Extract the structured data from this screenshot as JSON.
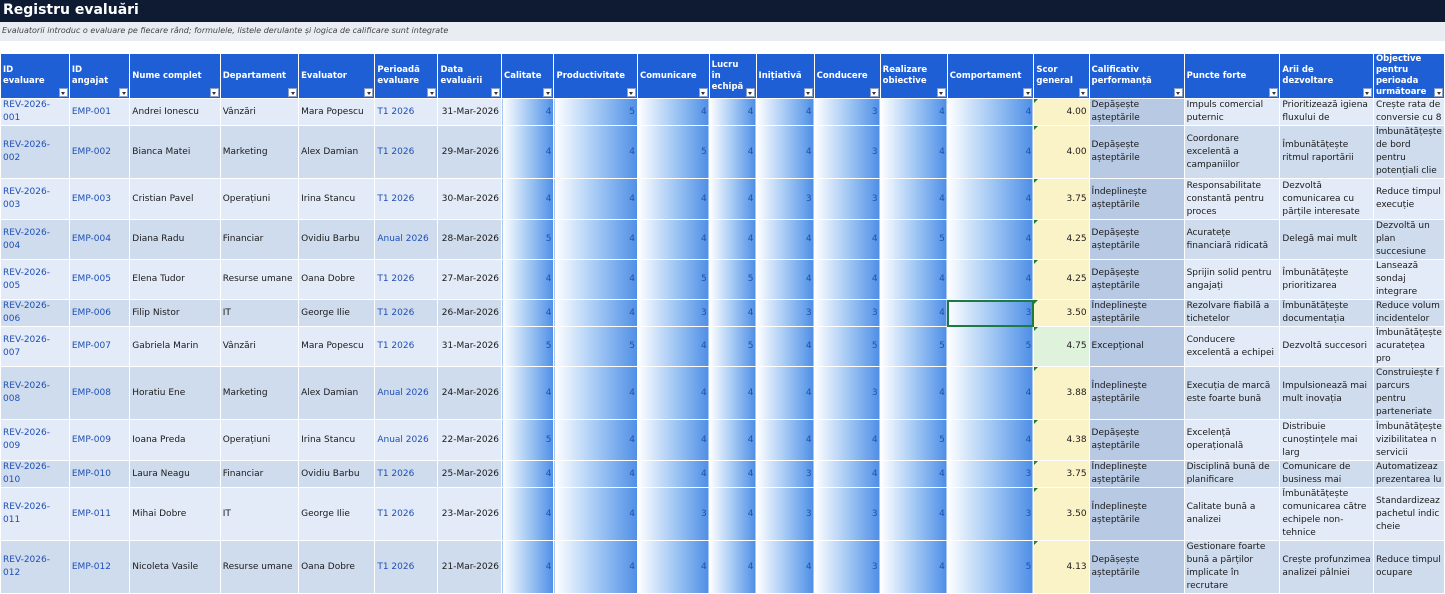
{
  "sheet": {
    "title": "Registru evaluări",
    "subtitle": "Evaluatorii introduc o evaluare pe fiecare rând; formulele, listele derulante și logica de calificare sunt integrate"
  },
  "columns": [
    "ID evaluare",
    "ID angajat",
    "Nume complet",
    "Departament",
    "Evaluator",
    "Perioadă evaluare",
    "Data evaluării",
    "Calitate",
    "Productivitate",
    "Comunicare",
    "Lucru în echipă",
    "Inițiativă",
    "Conducere",
    "Realizare obiective",
    "Comportament",
    "Scor general",
    "Calificativ performanță",
    "Puncte forte",
    "Arii de dezvoltare",
    "Objective pentru perioada următoare"
  ],
  "rows": [
    [
      "REV-2026-001",
      "EMP-001",
      "Andrei Ionescu",
      "Vânzări",
      "Mara Popescu",
      "T1 2026",
      "31-Mar-2026",
      "4",
      "5",
      "4",
      "4",
      "4",
      "3",
      "4",
      "4",
      "4.00",
      "Depășește așteptările",
      "Impuls comercial puternic",
      "Prioritizează igiena fluxului de",
      "Crește rata de conversie cu 8"
    ],
    [
      "REV-2026-002",
      "EMP-002",
      "Bianca Matei",
      "Marketing",
      "Alex Damian",
      "T1 2026",
      "29-Mar-2026",
      "4",
      "4",
      "5",
      "4",
      "4",
      "3",
      "4",
      "4",
      "4.00",
      "Depășește așteptările",
      "Coordonare excelentă a campaniilor",
      "Îmbunătățește ritmul raportării",
      "Îmbunătățește de bord pentru potențiali clie"
    ],
    [
      "REV-2026-003",
      "EMP-003",
      "Cristian Pavel",
      "Operațiuni",
      "Irina Stancu",
      "T1 2026",
      "30-Mar-2026",
      "4",
      "4",
      "4",
      "4",
      "3",
      "3",
      "4",
      "4",
      "3.75",
      "Îndeplinește așteptările",
      "Responsabilitate constantă pentru proces",
      "Dezvoltă comunicarea cu părțile interesate",
      "Reduce timpul execuție"
    ],
    [
      "REV-2026-004",
      "EMP-004",
      "Diana Radu",
      "Financiar",
      "Ovidiu Barbu",
      "Anual 2026",
      "28-Mar-2026",
      "5",
      "4",
      "4",
      "4",
      "4",
      "4",
      "5",
      "4",
      "4.25",
      "Depășește așteptările",
      "Acuratețe financiară ridicată",
      "Delegă mai mult",
      "Dezvoltă un plan succesiune"
    ],
    [
      "REV-2026-005",
      "EMP-005",
      "Elena Tudor",
      "Resurse umane",
      "Oana Dobre",
      "T1 2026",
      "27-Mar-2026",
      "4",
      "4",
      "5",
      "5",
      "4",
      "4",
      "4",
      "4",
      "4.25",
      "Depășește așteptările",
      "Sprijin solid pentru angajați",
      "Îmbunătățește prioritizarea",
      "Lansează sondaj integrare"
    ],
    [
      "REV-2026-006",
      "EMP-006",
      "Filip Nistor",
      "IT",
      "George Ilie",
      "T1 2026",
      "26-Mar-2026",
      "4",
      "4",
      "3",
      "4",
      "3",
      "3",
      "4",
      "3",
      "3.50",
      "Îndeplinește așteptările",
      "Rezolvare fiabilă a tichetelor",
      "Îmbunătățește documentația",
      "Reduce volum incidentelor"
    ],
    [
      "REV-2026-007",
      "EMP-007",
      "Gabriela Marin",
      "Vânzări",
      "Mara Popescu",
      "T1 2026",
      "31-Mar-2026",
      "5",
      "5",
      "4",
      "5",
      "4",
      "5",
      "5",
      "5",
      "4.75",
      "Excepțional",
      "Conducere excelentă a echipei",
      "Dezvoltă succesori",
      "Îmbunătățește acuratețea pro"
    ],
    [
      "REV-2026-008",
      "EMP-008",
      "Horatiu Ene",
      "Marketing",
      "Alex Damian",
      "Anual 2026",
      "24-Mar-2026",
      "4",
      "4",
      "4",
      "4",
      "4",
      "3",
      "4",
      "4",
      "3.88",
      "Îndeplinește așteptările",
      "Execuția de marcă este foarte bună",
      "Impulsionează mai mult inovația",
      "Construiește f parcurs pentru parteneriate"
    ],
    [
      "REV-2026-009",
      "EMP-009",
      "Ioana Preda",
      "Operațiuni",
      "Irina Stancu",
      "Anual 2026",
      "22-Mar-2026",
      "5",
      "4",
      "4",
      "4",
      "4",
      "4",
      "5",
      "4",
      "4.38",
      "Depășește așteptările",
      "Excelență operațională",
      "Distribuie cunoștințele mai larg",
      "Îmbunătățește vizibilitatea n servicii"
    ],
    [
      "REV-2026-010",
      "EMP-010",
      "Laura Neagu",
      "Financiar",
      "Ovidiu Barbu",
      "T1 2026",
      "25-Mar-2026",
      "4",
      "4",
      "4",
      "4",
      "3",
      "4",
      "4",
      "3",
      "3.75",
      "Îndeplinește așteptările",
      "Disciplină bună de planificare",
      "Comunicare de business mai",
      "Automatizeaz prezentarea lu"
    ],
    [
      "REV-2026-011",
      "EMP-011",
      "Mihai Dobre",
      "IT",
      "George Ilie",
      "T1 2026",
      "23-Mar-2026",
      "4",
      "4",
      "3",
      "4",
      "3",
      "3",
      "4",
      "3",
      "3.50",
      "Îndeplinește așteptările",
      "Calitate bună a analizei",
      "Îmbunătățește comunicarea către echipele non-tehnice",
      "Standardizeaz pachetul indic cheie"
    ],
    [
      "REV-2026-012",
      "EMP-012",
      "Nicoleta Vasile",
      "Resurse umane",
      "Oana Dobre",
      "T1 2026",
      "21-Mar-2026",
      "4",
      "4",
      "4",
      "4",
      "4",
      "3",
      "4",
      "5",
      "4.13",
      "Depășește așteptările",
      "Gestionare foarte bună a părților implicate în recrutare",
      "Crește profunzimea analizei pâlniei",
      "Reduce timpul ocupare"
    ]
  ],
  "selected_cell": {
    "row": 5,
    "column": "Comportament"
  }
}
